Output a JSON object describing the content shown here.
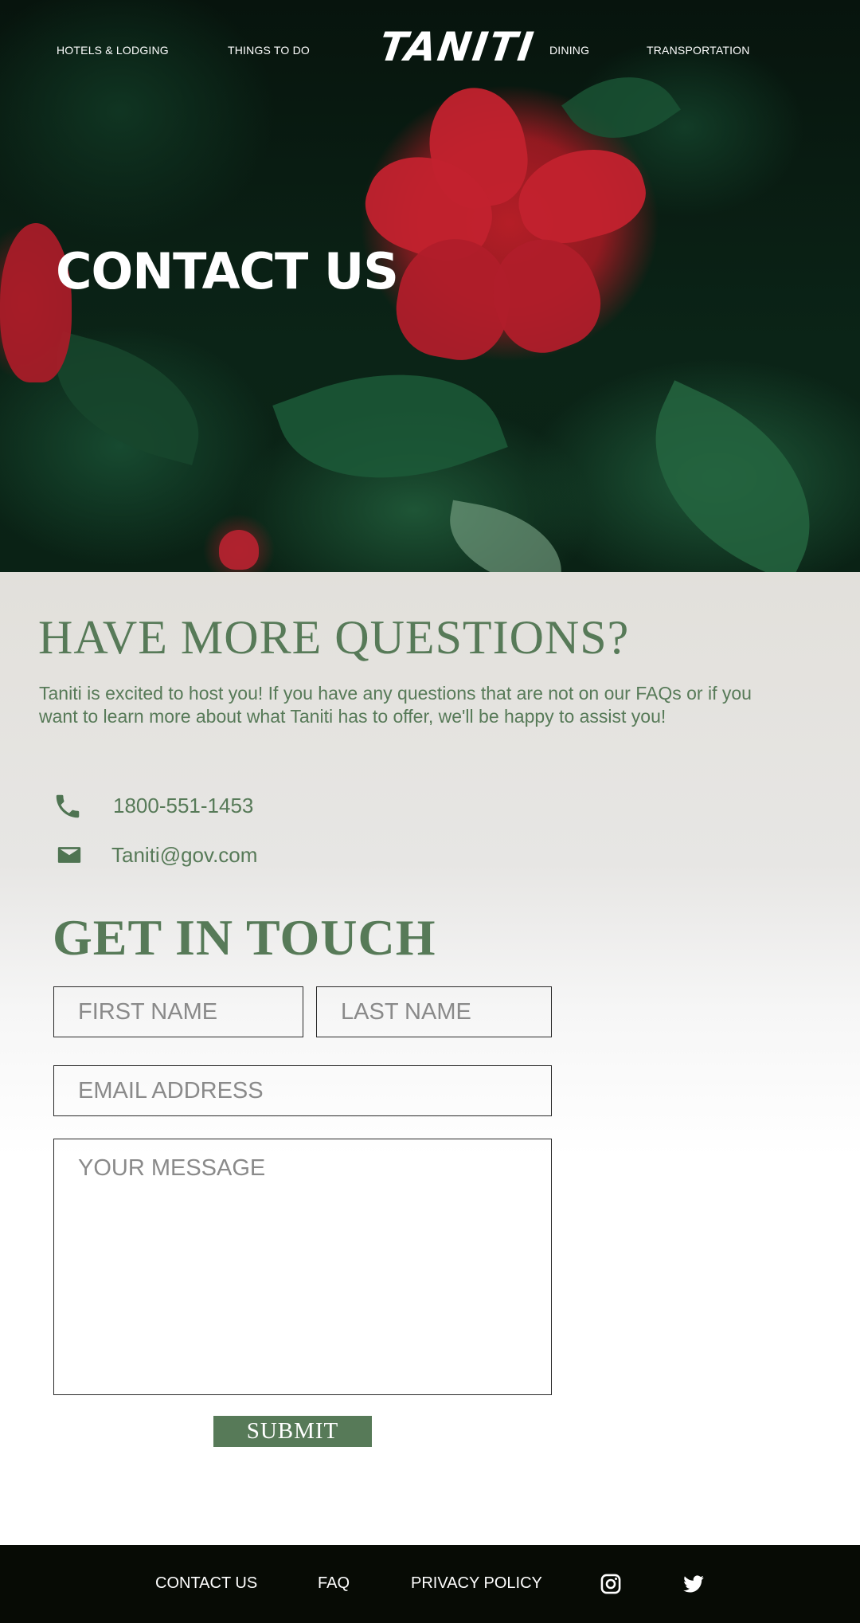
{
  "nav": {
    "hotels": "HOTELS & LODGING",
    "things": "THINGS TO DO",
    "logo": "TANITI",
    "dining": "DINING",
    "transport": "TRANSPORTATION"
  },
  "hero": {
    "title": "CONTACT US"
  },
  "questions": {
    "heading": "HAVE MORE QUESTIONS?",
    "intro": "Taniti is excited to host you! If you have any questions that are not on our FAQs or if you want to learn more about what Taniti has to offer, we'll be happy to assist you!",
    "phone": "1800-551-1453",
    "email": "Taniti@gov.com"
  },
  "form": {
    "heading": "GET IN TOUCH",
    "first_name_placeholder": "FIRST NAME",
    "last_name_placeholder": "LAST NAME",
    "email_placeholder": "EMAIL ADDRESS",
    "message_placeholder": "YOUR MESSAGE",
    "submit_label": "SUBMIT"
  },
  "footer": {
    "contact": "CONTACT US",
    "faq": "FAQ",
    "privacy": "PRIVACY POLICY",
    "icons": [
      "instagram-icon",
      "twitter-icon"
    ]
  },
  "colors": {
    "accent": "#577a58",
    "footer_bg": "#070b05",
    "hero_red": "#c2222e"
  }
}
